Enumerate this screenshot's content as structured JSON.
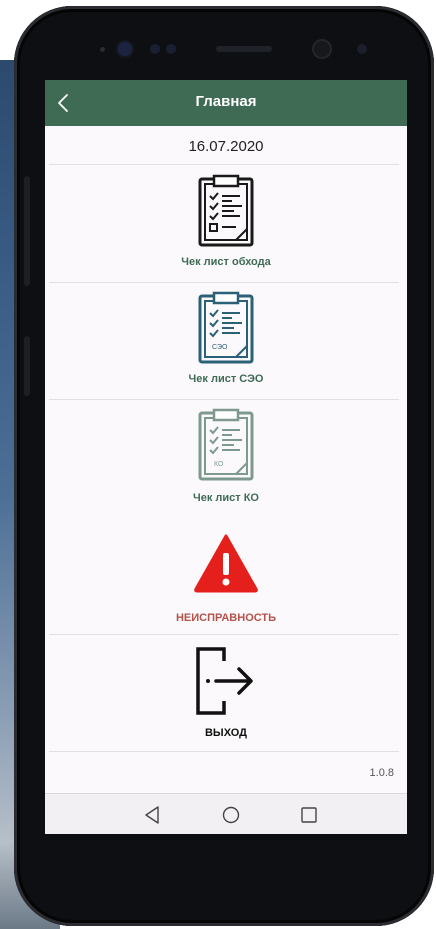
{
  "header": {
    "title": "Главная",
    "back_icon": "chevron-left-icon"
  },
  "date": "16.07.2020",
  "menu": {
    "checklist_walk": {
      "label": "Чек лист обхода",
      "icon": "clipboard-checklist-icon",
      "color": "#3f6b55"
    },
    "checklist_seo": {
      "label": "Чек лист СЭО",
      "icon_text": "СЭО",
      "icon": "clipboard-checklist-icon",
      "color": "#3f6b55",
      "icon_color": "#2b6176"
    },
    "checklist_ko": {
      "label": "Чек лист КО",
      "icon_text": "КО",
      "icon": "clipboard-checklist-icon",
      "color": "#3f6b55",
      "icon_color": "#7e9a8e"
    },
    "malfunction": {
      "label": "НЕИСПРАВНОСТЬ",
      "icon": "warning-triangle-icon",
      "color": "#b5534b",
      "icon_color": "#e5201c"
    },
    "exit": {
      "label": "ВЫХОД",
      "icon": "logout-icon",
      "color": "#111111"
    }
  },
  "version": "1.0.8",
  "navbar": {
    "back": "triangle-back-icon",
    "home": "circle-home-icon",
    "recents": "square-recents-icon"
  }
}
